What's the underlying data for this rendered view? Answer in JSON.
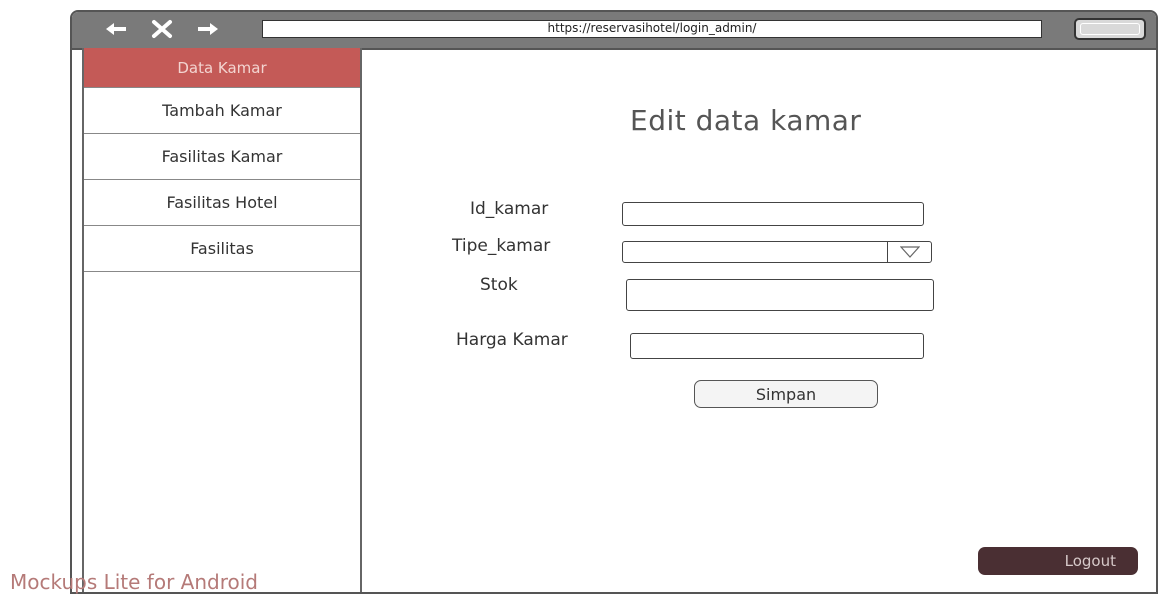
{
  "browser": {
    "url": "https://reservasihotel/login_admin/",
    "icons": [
      "back-arrow-icon",
      "close-icon",
      "forward-arrow-icon"
    ]
  },
  "sidebar": {
    "items": [
      {
        "label": "Data Kamar",
        "active": true
      },
      {
        "label": "Tambah Kamar",
        "active": false
      },
      {
        "label": "Fasilitas Kamar",
        "active": false
      },
      {
        "label": "Fasilitas Hotel",
        "active": false
      },
      {
        "label": "Fasilitas",
        "active": false
      }
    ]
  },
  "form": {
    "title": "Edit data kamar",
    "fields": {
      "id_kamar": {
        "label": "Id_kamar",
        "value": ""
      },
      "tipe_kamar": {
        "label": "Tipe_kamar",
        "value": ""
      },
      "stok": {
        "label": "Stok",
        "value": ""
      },
      "harga_kamar": {
        "label": "Harga Kamar",
        "value": ""
      }
    },
    "save_label": "Simpan"
  },
  "logout_label": "Logout",
  "watermark": "Mockups Lite for Android",
  "colors": {
    "active_sidebar": "#c45a57",
    "logout_bg": "#4a2f33",
    "browser_bar": "#7a7a7a"
  }
}
